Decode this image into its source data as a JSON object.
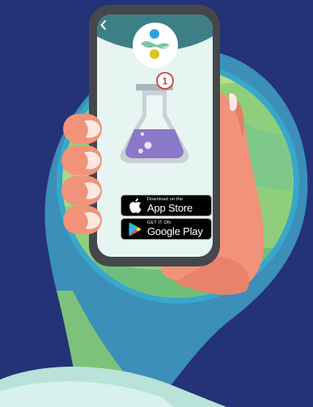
{
  "app_store": {
    "top_line": "Download on the",
    "name": "App Store"
  },
  "google_play": {
    "top_line": "GET IT ON",
    "name": "Google Play"
  },
  "step_badge": {
    "number": "1"
  },
  "icons": {
    "back": "chevron-left-icon",
    "app_logo": "app-logo-icon",
    "flask": "flask-icon",
    "apple": "apple-icon",
    "google_play": "google-play-icon"
  },
  "colors": {
    "background": "#243277",
    "screen": "#e6f4f2",
    "phone_frame": "#45474c",
    "flask_liquid": "#8a78c8",
    "skin": "#f1937a",
    "step_badge": "#c94444",
    "logo_blue": "#2aa5dc",
    "logo_green": "#7bc49c",
    "logo_yellow": "#d9c61f"
  }
}
